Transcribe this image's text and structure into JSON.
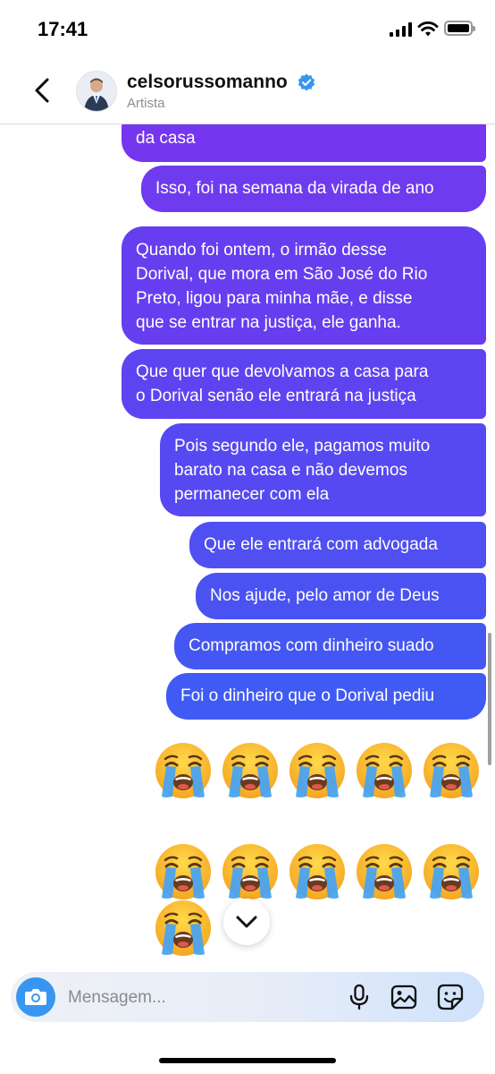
{
  "status_bar": {
    "time": "17:41"
  },
  "header": {
    "username": "celsorussomanno",
    "subtitle": "Artista"
  },
  "messages": [
    "da casa",
    "Isso, foi na semana da virada de ano",
    "Quando foi ontem, o irmão desse\nDorival, que mora em São José do Rio\nPreto, ligou para minha mãe, e disse\nque se entrar na justiça, ele ganha.",
    "Que quer que devolvamos a casa para\no Dorival senão ele entrará na justiça",
    "Pois segundo ele, pagamos muito\nbarato na casa e não devemos\npermanecer com ela",
    "Que ele entrará com advogada",
    "Nos ajude, pelo amor de Deus",
    "Compramos com dinheiro suado",
    "Foi o dinheiro que o Dorival pediu"
  ],
  "emoji_reaction": {
    "icon": "loudly-crying-face-icon",
    "count": 11
  },
  "composer": {
    "placeholder": "Mensagem..."
  },
  "colors": {
    "bubble_top": "#7635ef",
    "bubble_bottom": "#3e5cf2",
    "accent_blue": "#3797f0"
  }
}
